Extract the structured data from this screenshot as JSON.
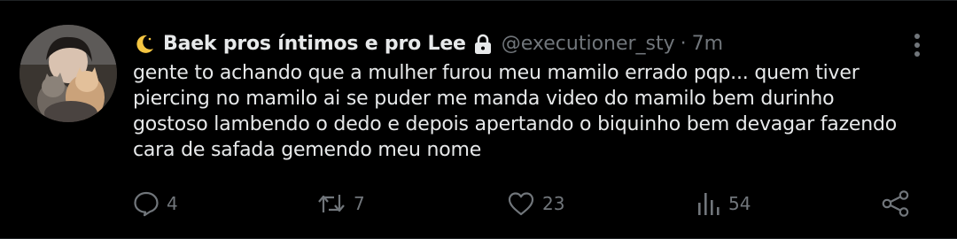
{
  "tweet": {
    "display_name": "Baek pros íntimos e pro Lee",
    "handle": "@executioner_sty",
    "separator": "·",
    "time": "7m",
    "text": "gente to achando que a mulher furou meu mamilo errado pqp... quem tiver\npiercing no mamilo ai se puder me manda video do mamilo bem durinho\ngostoso lambendo o dedo e depois apertando o biquinho bem devagar fazendo\ncara de safada gemendo meu nome",
    "icons": {
      "name_emoji": "crescent-moon-icon",
      "protected": "lock-icon",
      "more": "more-vertical-icon"
    }
  },
  "actions": {
    "reply_count": "4",
    "retweet_count": "7",
    "like_count": "23",
    "views_count": "54"
  },
  "colors": {
    "background": "#000000",
    "text": "#e7e9ea",
    "secondary": "#71767b",
    "moon": "#f4c542"
  }
}
